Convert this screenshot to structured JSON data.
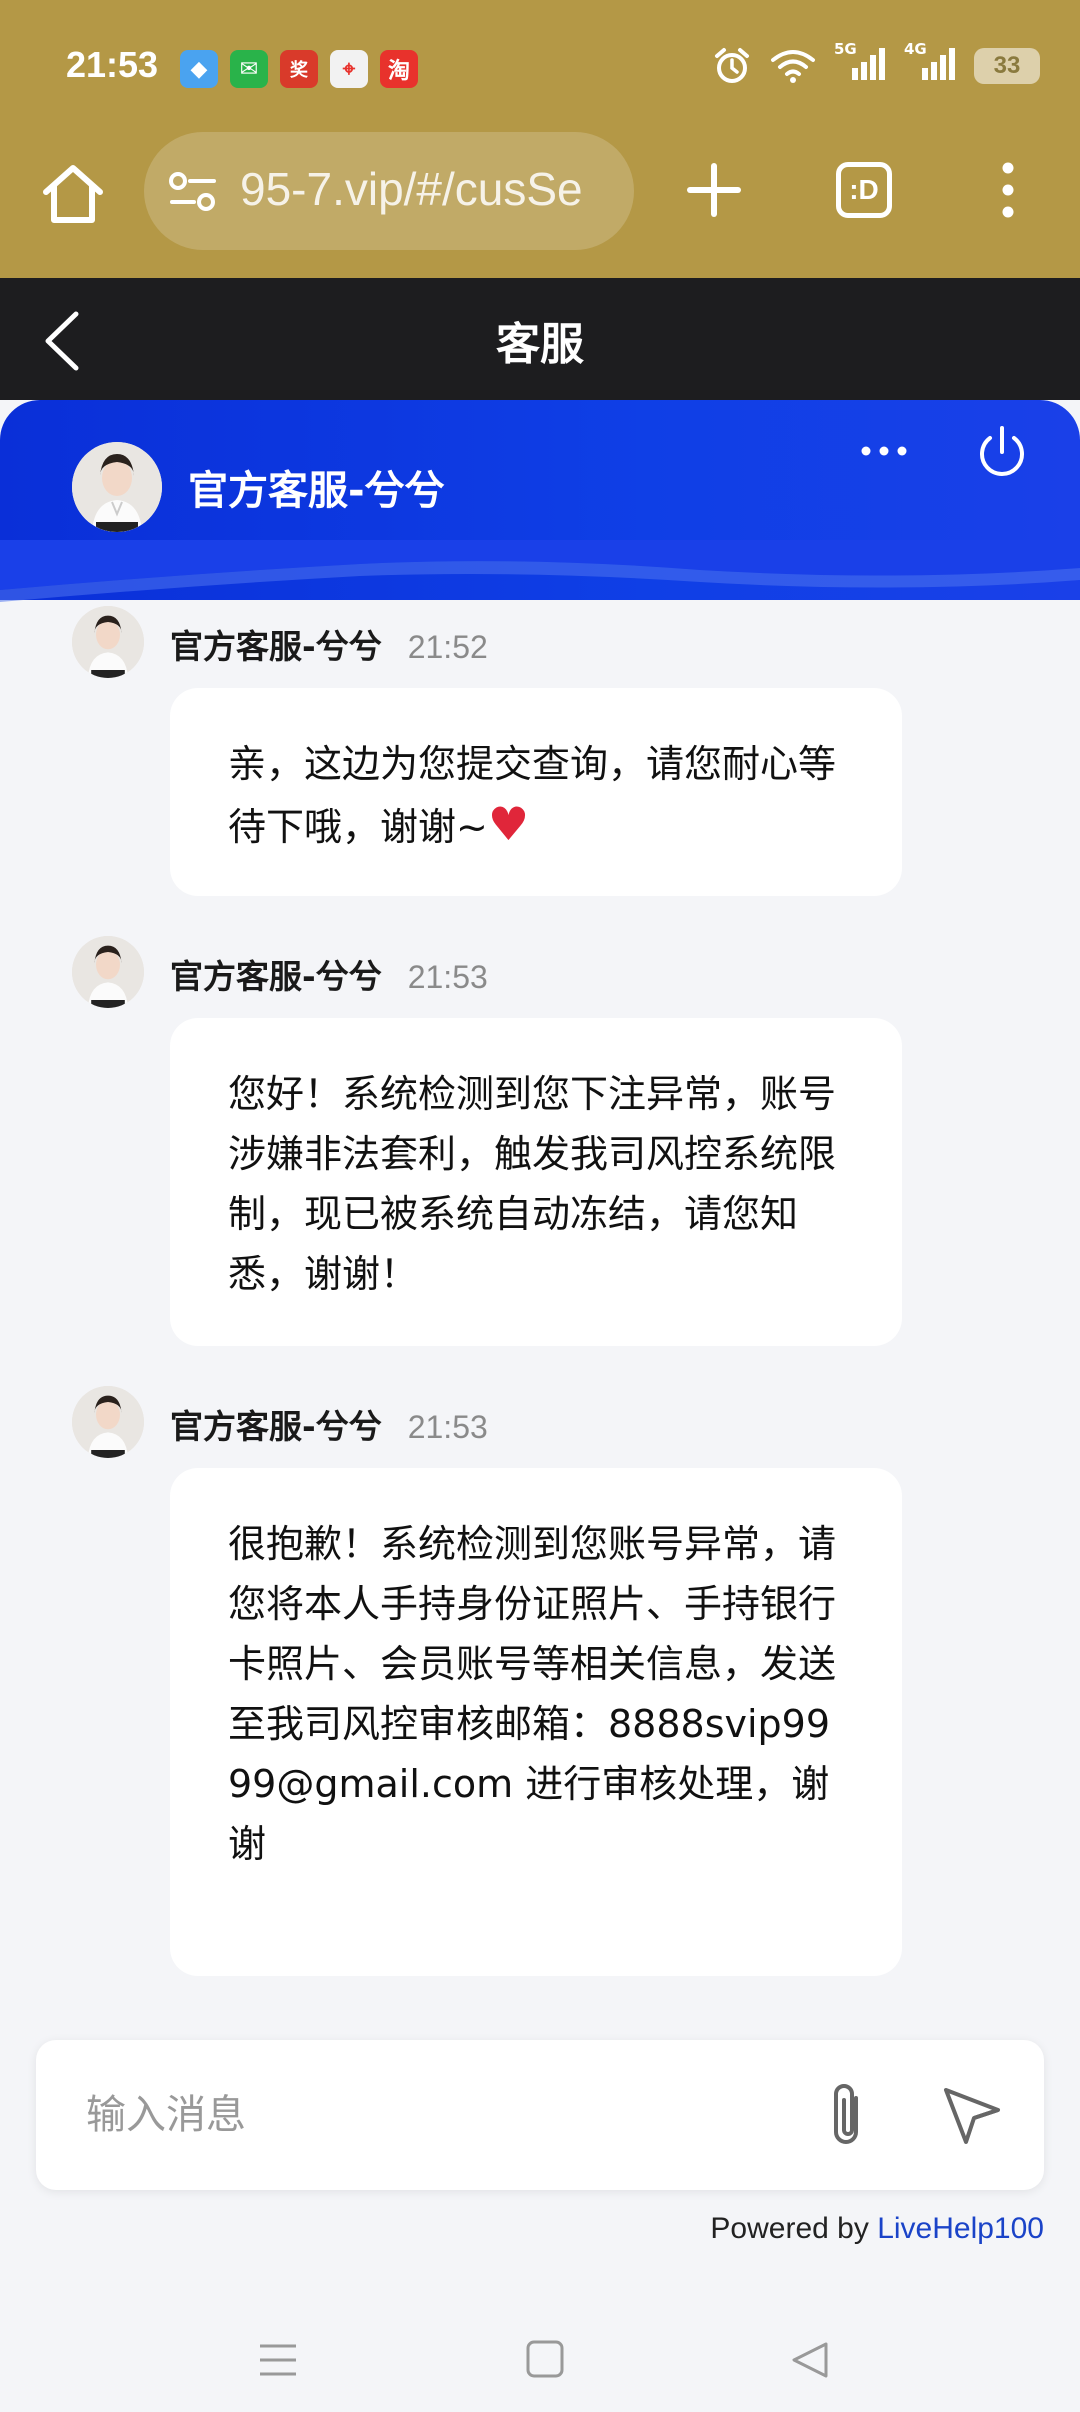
{
  "status_bar": {
    "time": "21:53",
    "app_icons": [
      "browser-icon",
      "wechat-icon",
      "game-icon",
      "maps-icon",
      "taobao-icon"
    ],
    "app_glyphs": [
      "◆",
      "✉",
      "奖",
      "⌖",
      "淘"
    ],
    "app_colors": [
      "#4aa3f0",
      "#29b34a",
      "#d93a2a",
      "#f2f2f2",
      "#e8322c"
    ],
    "network_5g": "5G",
    "network_4g": "4G",
    "battery": "33"
  },
  "browser": {
    "url": "95-7.vip/#/cusSe",
    "tabs_label": ":D"
  },
  "app_header": {
    "title": "客服"
  },
  "chat_header": {
    "agent_name": "官方客服-兮兮",
    "colors": {
      "primary": "#0f3fe6"
    }
  },
  "messages": [
    {
      "name": "官方客服-兮兮",
      "time": "21:52",
      "text": "亲，这边为您提交查询，请您耐心等待下哦，谢谢~",
      "emoji": "♥"
    },
    {
      "name": "官方客服-兮兮",
      "time": "21:53",
      "text": "您好！系统检测到您下注异常，账号涉嫌非法套利，触发我司风控系统限制，现已被系统自动冻结，请您知悉，谢谢！"
    },
    {
      "name": "官方客服-兮兮",
      "time": "21:53",
      "text": "很抱歉！系统检测到您账号异常，请您将本人手持身份证照片、手持银行卡照片、会员账号等相关信息，发送至我司风控审核邮箱：8888svip9999@gmail.com 进行审核处理，谢谢"
    }
  ],
  "composer": {
    "placeholder": "输入消息"
  },
  "footer": {
    "powered_prefix": "Powered by",
    "powered_brand": "LiveHelp100"
  }
}
